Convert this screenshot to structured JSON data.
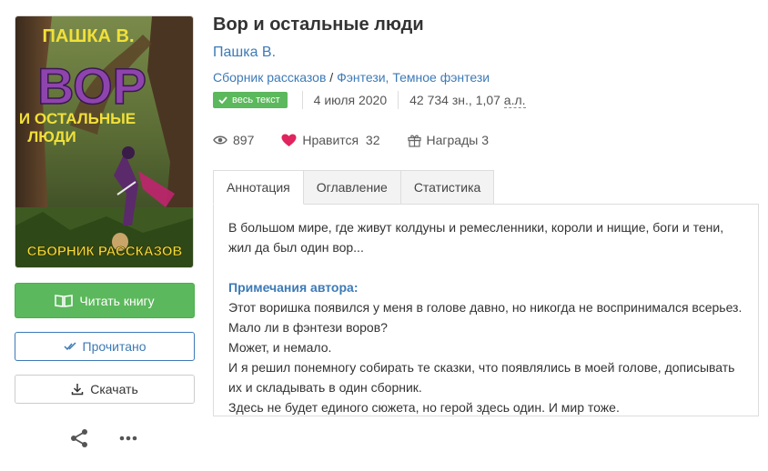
{
  "book": {
    "title": "Вор и остальные люди",
    "author": "Пашка В.",
    "genres": [
      "Сборник рассказов",
      "Фэнтези, Темное фэнтези"
    ],
    "genre_separator": " / ",
    "badge": "весь текст",
    "date": "4 июля 2020",
    "size": "42 734 зн., 1,07",
    "size_unit": "а.л.",
    "views": "897",
    "likes_label": "Нравится",
    "likes": "32",
    "awards_label": "Награды",
    "awards": "3"
  },
  "cover": {
    "author": "ПАШКА В.",
    "title_big": "ВОР",
    "subtitle_1": "И ОСТАЛЬНЫЕ",
    "subtitle_2": "ЛЮДИ",
    "bottom": "СБОРНИК РАССКАЗОВ"
  },
  "actions": {
    "read": "Читать книгу",
    "done": "Прочитано",
    "download": "Скачать"
  },
  "tabs": [
    "Аннотация",
    "Оглавление",
    "Статистика"
  ],
  "annotation": {
    "text": "В большом мире, где живут колдуны и ремесленники, короли и нищие, боги и тени, жил да был один вор...",
    "notes_title": "Примечания автора:",
    "notes": [
      "Этот воришка появился у меня в голове давно, но никогда не воспринимался всерьез.",
      "Мало ли в фэнтези воров?",
      "Может, и немало.",
      "И я решил понемногу собирать те сказки, что появлялись в моей голове, дописывать их и складывать в один сборник.",
      "Здесь не будет единого сюжета, но герой здесь один. И мир тоже."
    ]
  },
  "colors": {
    "accent": "#3d7ab6",
    "success": "#5cb85c",
    "heart": "#e0245e",
    "cover_title": "#8e44ad",
    "cover_text": "#f1e03a"
  }
}
